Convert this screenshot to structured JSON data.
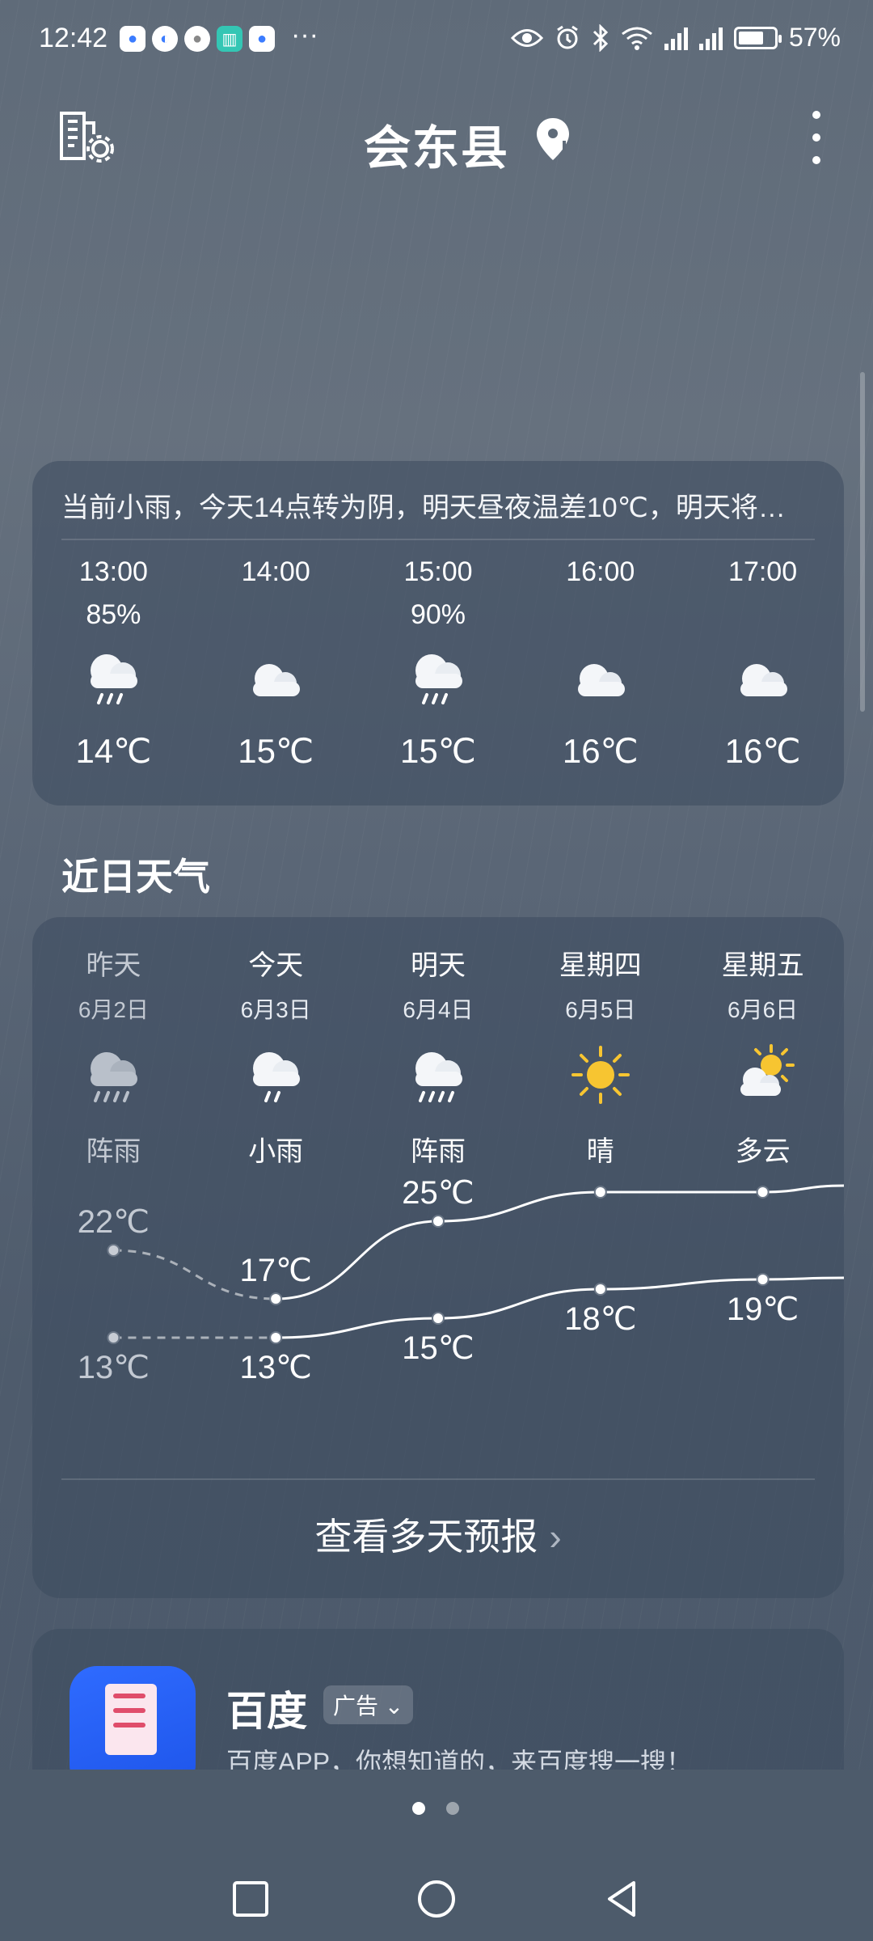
{
  "status_bar": {
    "time": "12:42",
    "more": "···",
    "battery": "57%"
  },
  "header": {
    "title": "会东县"
  },
  "hourly": {
    "summary": "当前小雨，今天14点转为阴，明天昼夜温差10℃，明天将…",
    "items": [
      {
        "time": "13:00",
        "precip": "85%",
        "icon": "rain-cloud-icon",
        "temp": "14℃"
      },
      {
        "time": "14:00",
        "precip": "",
        "icon": "cloud-icon",
        "temp": "15℃"
      },
      {
        "time": "15:00",
        "precip": "90%",
        "icon": "rain-cloud-icon",
        "temp": "15℃"
      },
      {
        "time": "16:00",
        "precip": "",
        "icon": "cloud-icon",
        "temp": "16℃"
      },
      {
        "time": "17:00",
        "precip": "",
        "icon": "cloud-icon",
        "temp": "16℃"
      }
    ]
  },
  "daily": {
    "section_title": "近日天气",
    "days": [
      {
        "name": "昨天",
        "date": "6月2日",
        "icon": "shower-icon",
        "condition": "阵雨",
        "high": "22℃",
        "low": "13℃"
      },
      {
        "name": "今天",
        "date": "6月3日",
        "icon": "light-rain-icon",
        "condition": "小雨",
        "high": "17℃",
        "low": "13℃"
      },
      {
        "name": "明天",
        "date": "6月4日",
        "icon": "shower-icon",
        "condition": "阵雨",
        "high": "25℃",
        "low": "15℃"
      },
      {
        "name": "星期四",
        "date": "6月5日",
        "icon": "sun-icon",
        "condition": "晴",
        "high": "28℃",
        "low": "18℃"
      },
      {
        "name": "星期五",
        "date": "6月6日",
        "icon": "partly-cloudy-icon",
        "condition": "多云",
        "high": "28℃",
        "low": "19℃"
      }
    ],
    "more_label": "查看多天预报"
  },
  "chart_data": {
    "type": "line",
    "categories": [
      "昨天",
      "今天",
      "明天",
      "星期四",
      "星期五"
    ],
    "series": [
      {
        "values": [
          22,
          17,
          25,
          28,
          28
        ]
      },
      {
        "values": [
          13,
          13,
          15,
          18,
          19
        ]
      }
    ],
    "data_labels_high": [
      "22℃",
      "17℃",
      "25℃",
      "28℃",
      "28℃"
    ],
    "data_labels_low": [
      "13℃",
      "13℃",
      "15℃",
      "18℃",
      "19℃"
    ],
    "grid": false
  },
  "ad": {
    "name": "百度",
    "tag": "广告",
    "description": "百度APP，你想知道的，来百度搜一搜！"
  },
  "pager": {
    "count": 2,
    "active": 0
  },
  "colors": {
    "accent_sun": "#f7c531",
    "card": "#3c4a5e"
  }
}
